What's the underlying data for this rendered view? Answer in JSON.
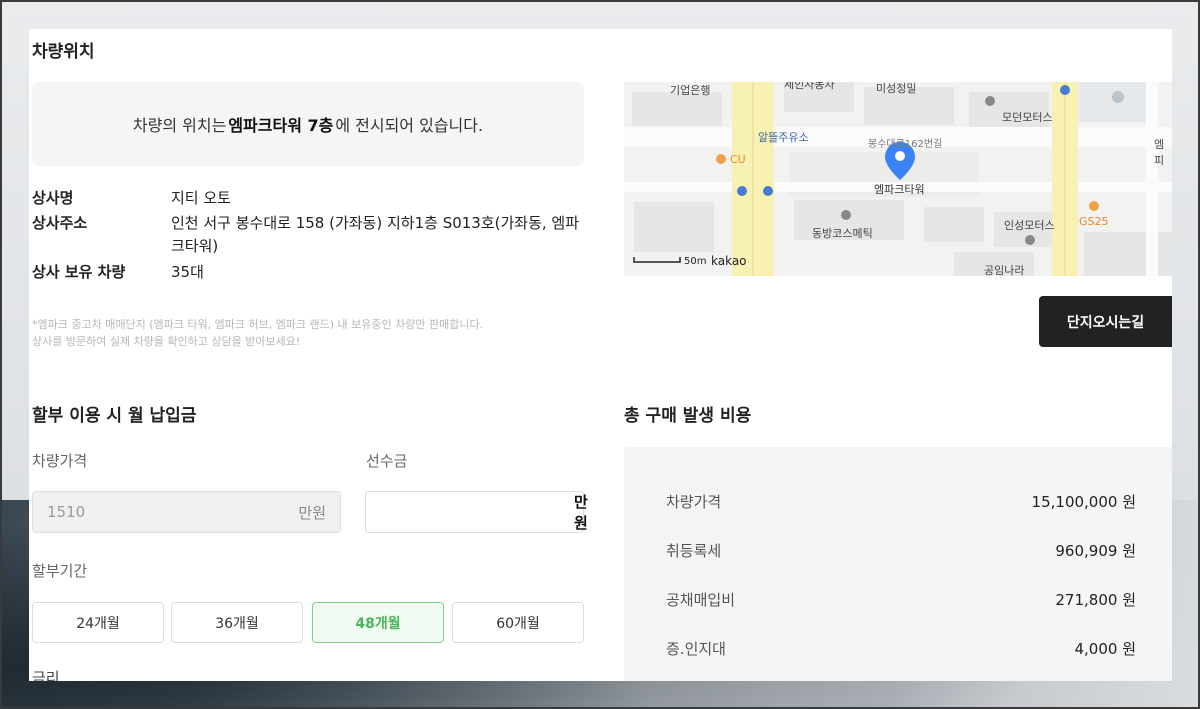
{
  "location": {
    "title": "차량위치",
    "notice_prefix": "차량의 위치는",
    "notice_place": "엠파크타워 7층",
    "notice_suffix": "에 전시되어 있습니다.",
    "dealer_name_label": "상사명",
    "dealer_name": "지티 오토",
    "dealer_address_label": "상사주소",
    "dealer_address": "인천 서구 봉수대로 158 (가좌동) 지하1층 S013호(가좌동, 엠파크타워)",
    "dealer_stock_label": "상사 보유 차량",
    "dealer_stock": "35대",
    "note_line1": "*엠파크 중고차 매매단지 (엠파크 타워, 엠파크 허브, 엠파크 랜드) 내 보유중인 차량만 판매합니다.",
    "note_line2": "상사를 방문하여 실제 차량을 확인하고 상담을 받아보세요!",
    "directions_button": "단지오시는길"
  },
  "map": {
    "labels": {
      "bank": "기업은행",
      "top_center": "세인자동차",
      "top_right": "미성정밀",
      "modern": "모던모터스",
      "gas": "알뜰주유소",
      "road": "봉수대로162번길",
      "cu": "CU",
      "tower": "엠파크타워",
      "dongbang": "동방코스메틱",
      "inseong": "인성모터스",
      "gs25": "GS25",
      "gongin": "공임나라",
      "right_edge": "엠피",
      "scale": "50m",
      "brand": "kakao"
    },
    "colors": {
      "road": "#f7f1b4",
      "pin": "#3b82f6",
      "poi": "#f0a24a"
    }
  },
  "installment": {
    "title": "할부 이용 시 월 납입금",
    "price_label": "차량가격",
    "price_value": "1510",
    "price_unit": "만원",
    "down_label": "선수금",
    "down_value": "",
    "down_unit": "만원",
    "term_label": "할부기간",
    "terms": [
      "24개월",
      "36개월",
      "48개월",
      "60개월"
    ],
    "selected_term": "48개월",
    "rate_label": "금리"
  },
  "total_cost": {
    "title": "총 구매 발생 비용",
    "rows": [
      {
        "label": "차량가격",
        "value": "15,100,000 원"
      },
      {
        "label": "취등록세",
        "value": "960,909 원"
      },
      {
        "label": "공채매입비",
        "value": "271,800 원"
      },
      {
        "label": "증.인지대",
        "value": "4,000 원"
      }
    ]
  }
}
